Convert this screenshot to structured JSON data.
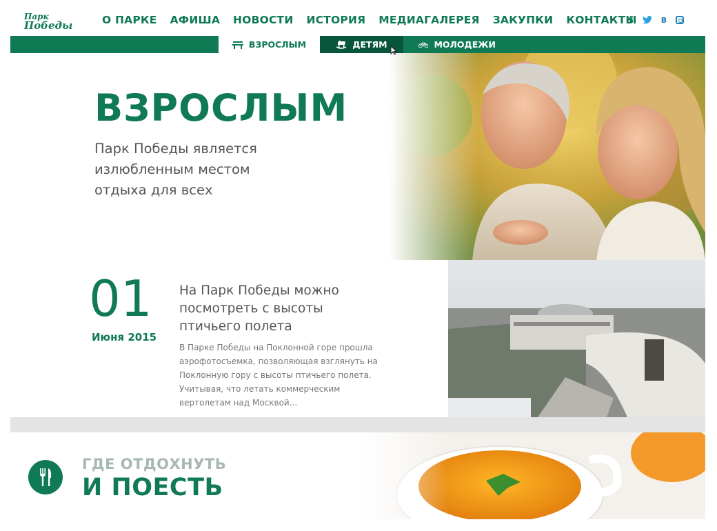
{
  "brand": {
    "logo_line1": "Парк",
    "logo_line2": "Победы"
  },
  "nav": [
    "О ПАРКЕ",
    "АФИША",
    "НОВОСТИ",
    "ИСТОРИЯ",
    "МЕДИАГАЛЕРЕЯ",
    "ЗАКУПКИ",
    "КОНТАКТЫ"
  ],
  "social": {
    "facebook": "f",
    "vk": "В"
  },
  "tabs": {
    "adults": "ВЗРОСЛЫМ",
    "kids": "ДЕТЯМ",
    "youth": "МОЛОДЕЖИ"
  },
  "hero": {
    "title": "ВЗРОСЛЫМ",
    "subtitle": "Парк Победы является излюбленным местом отдыха для всех"
  },
  "news": {
    "day": "01",
    "month": "Июня 2015",
    "title": "На Парк Победы можно посмотреть с высоты птичьего полета",
    "text": "В Парке Победы на Поклонной горе прошла аэрофотосъемка, позволяющая взглянуть на Поклонную гору с высоты птичьего полета. Учитывая, что летать коммерческим вертолетам над Москвой..."
  },
  "food": {
    "line1": "ГДЕ ОТДОХНУТЬ",
    "line2": "И ПОЕСТЬ"
  },
  "colors": {
    "brand_green": "#0f7a54",
    "tab_hover": "#07553a",
    "divider": "#e4e4e4"
  },
  "icons": [
    "facebook-icon",
    "twitter-icon",
    "vk-icon",
    "instagram-icon",
    "bench-icon",
    "rocking-horse-icon",
    "bicycle-icon",
    "fork-knife-icon",
    "cursor-icon"
  ]
}
